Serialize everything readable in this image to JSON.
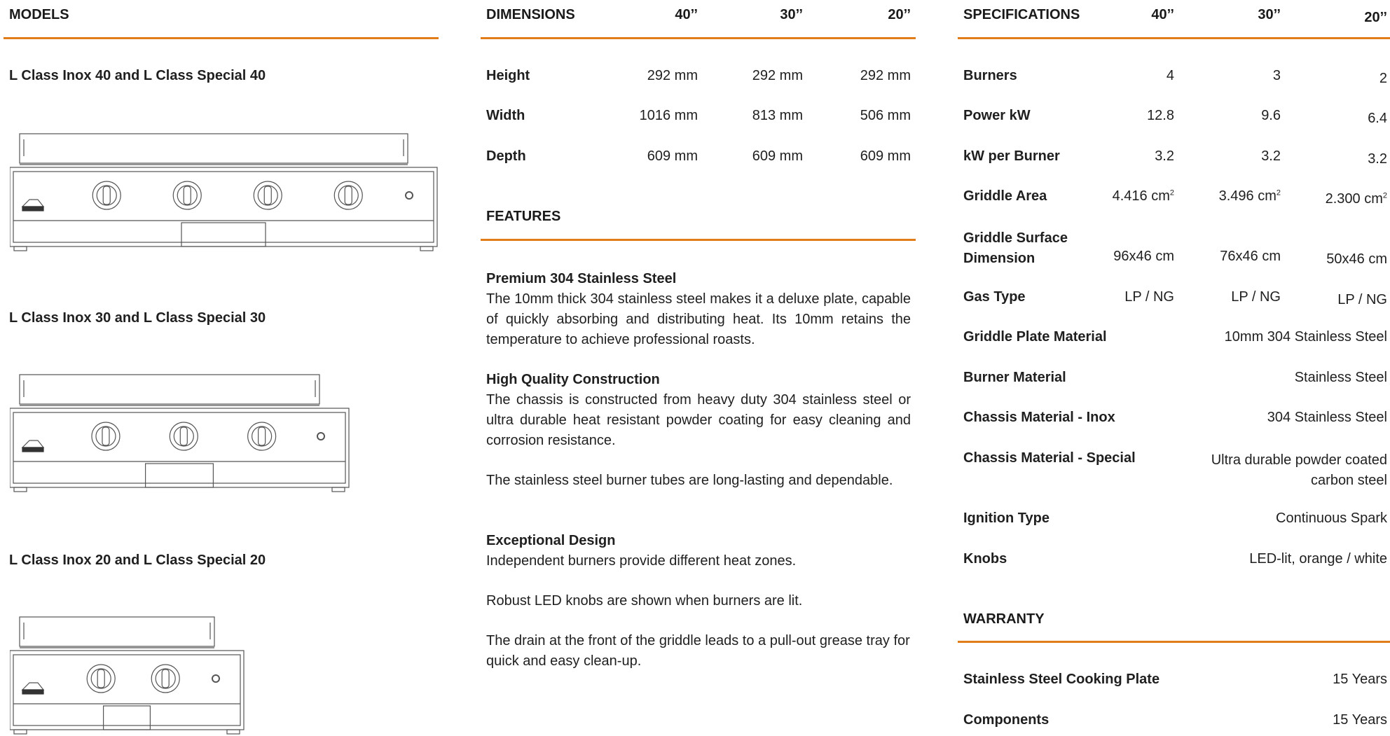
{
  "models": {
    "header": "MODELS",
    "items": [
      {
        "title": "L Class Inox 40 and L Class Special 40",
        "burners": 4
      },
      {
        "title": "L Class Inox 30 and L Class Special 30",
        "burners": 3
      },
      {
        "title": "L Class Inox 20 and L Class Special 20",
        "burners": 2
      }
    ]
  },
  "dimensions": {
    "header": "DIMENSIONS",
    "columns": [
      "40’’",
      "30’’",
      "20’’"
    ],
    "rows": [
      {
        "label": "Height",
        "values": [
          "292  mm",
          "292 mm",
          "292 mm"
        ]
      },
      {
        "label": "Width",
        "values": [
          "1016 mm",
          "813 mm",
          "506 mm"
        ]
      },
      {
        "label": "Depth",
        "values": [
          "609 mm",
          "609 mm",
          "609 mm"
        ]
      }
    ]
  },
  "features": {
    "header": "FEATURES",
    "blocks": [
      {
        "title": "Premium 304 Stainless Steel",
        "text": "The 10mm thick 304 stainless steel makes it a deluxe plate, capable of quickly absorbing and distributing heat. Its 10mm retains the temperature to achieve professional roasts."
      },
      {
        "title": "High Quality Construction",
        "text": "The chassis is constructed from heavy duty 304 stainless steel or ultra durable heat resistant powder coating for easy cleaning and corrosion resistance."
      },
      {
        "title": "",
        "text": "The stainless steel burner tubes are long-lasting and dependable."
      },
      {
        "title": "Exceptional Design",
        "text": "Independent burners provide different heat zones."
      },
      {
        "title": "",
        "text": "Robust LED knobs are shown when burners are lit."
      },
      {
        "title": "",
        "text": "The drain at the front of the griddle leads to a pull-out grease tray for quick and easy clean-up."
      }
    ]
  },
  "specifications": {
    "header": "SPECIFICATIONS",
    "columns": [
      "40’’",
      "30’’",
      "20’’"
    ],
    "rows": [
      {
        "label": "Burners",
        "values": [
          "4",
          "3",
          "2"
        ]
      },
      {
        "label": "Power kW",
        "values": [
          "12.8",
          "9.6",
          "6.4"
        ]
      },
      {
        "label": "kW per Burner",
        "values": [
          "3.2",
          "3.2",
          "3.2"
        ]
      },
      {
        "label": "Griddle Area",
        "values": [
          "4.416 cm",
          "3.496 cm",
          "2.300 cm"
        ],
        "unit_sup": "2"
      },
      {
        "label": "Griddle Surface Dimension",
        "values": [
          "96x46 cm",
          "76x46 cm",
          "50x46 cm"
        ]
      },
      {
        "label": "Gas Type",
        "values": [
          "LP / NG",
          "LP / NG",
          "LP / NG"
        ]
      }
    ],
    "wide_rows": [
      {
        "label": "Griddle Plate Material",
        "value": "10mm 304 Stainless Steel"
      },
      {
        "label": "Burner Material",
        "value": "Stainless Steel"
      },
      {
        "label": "Chassis Material - Inox",
        "value": "304 Stainless Steel"
      },
      {
        "label": "Chassis Material - Special",
        "value": "Ultra durable powder coated carbon steel"
      },
      {
        "label": "Ignition Type",
        "value": "Continuous Spark"
      },
      {
        "label": "Knobs",
        "value": "LED-lit, orange / white"
      }
    ]
  },
  "warranty": {
    "header": "WARRANTY",
    "rows": [
      {
        "label": "Stainless Steel Cooking Plate",
        "value": "15 Years"
      },
      {
        "label": "Components",
        "value": "15 Years"
      }
    ]
  },
  "colors": {
    "accent": "#e07d18",
    "text": "#1f1f1f",
    "line": "#555555"
  }
}
